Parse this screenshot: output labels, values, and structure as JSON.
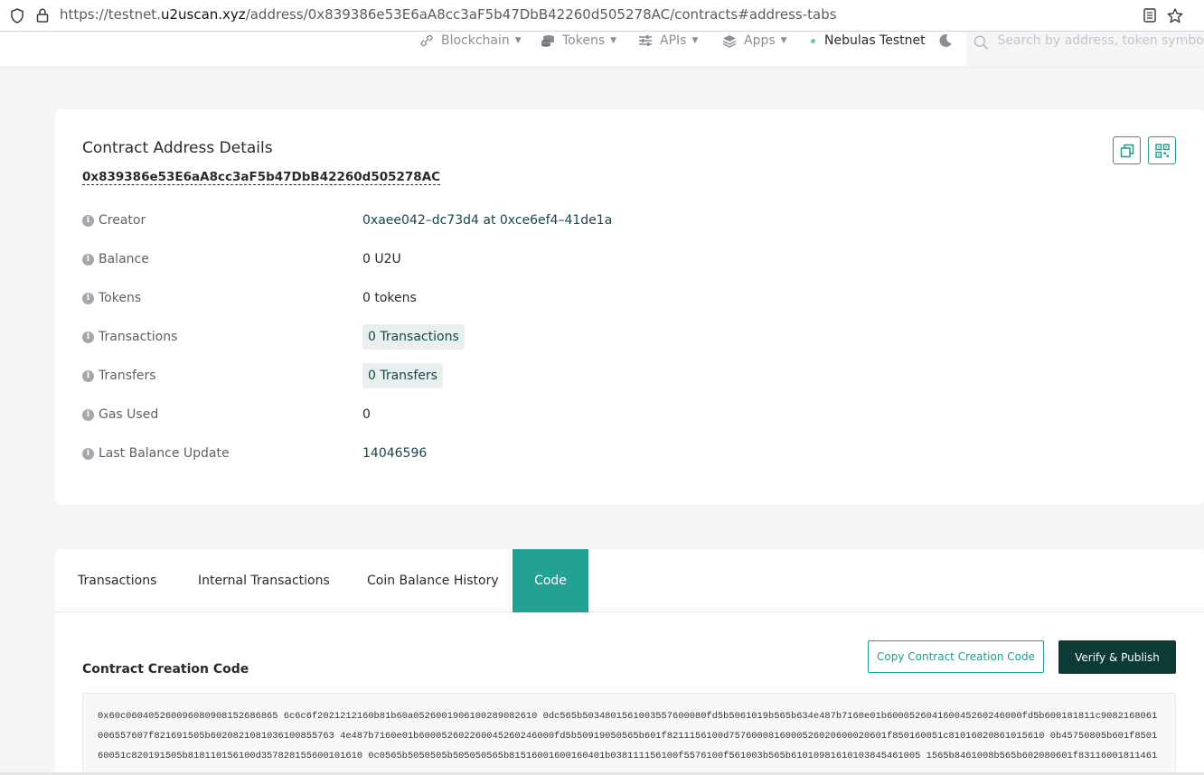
{
  "browser": {
    "url_prefix": "https://testnet.",
    "url_host": "u2uscan.xyz",
    "url_path": "/address/0x839386e53E6aA8cc3aF5b47DbB42260d505278AC/contracts#address-tabs"
  },
  "nav": {
    "items": [
      {
        "label": "Blockchain",
        "icon": "blockchain-icon"
      },
      {
        "label": "Tokens",
        "icon": "tokens-icon"
      },
      {
        "label": "APIs",
        "icon": "apis-icon"
      },
      {
        "label": "Apps",
        "icon": "apps-icon"
      }
    ],
    "network": "Nebulas Testnet",
    "network_dot_color": "#5ad18b",
    "search_placeholder": "Search by address, token symbol, n"
  },
  "details": {
    "title": "Contract Address Details",
    "address": "0x839386e53E6aA8cc3aF5b47DbB42260d505278AC",
    "rows": [
      {
        "label": "Creator",
        "value": "0xaee042–dc73d4 at 0xce6ef4–41de1a"
      },
      {
        "label": "Balance",
        "value": "0 U2U"
      },
      {
        "label": "Tokens",
        "value": "0 tokens"
      },
      {
        "label": "Transactions",
        "value": "0 Transactions"
      },
      {
        "label": "Transfers",
        "value": "0 Transfers"
      },
      {
        "label": "Gas Used",
        "value": "0"
      },
      {
        "label": "Last Balance Update",
        "value": "14046596"
      }
    ]
  },
  "tabs": [
    "Transactions",
    "Internal Transactions",
    "Coin Balance History",
    "Code"
  ],
  "active_tab": "Code",
  "code": {
    "title": "Contract Creation Code",
    "copy_button": "Copy Contract Creation Code",
    "verify_button": "Verify & Publish",
    "lines": [
      "0x60c060405260096080908152686865 6c6c6f2021212160b81b60a0526001906100289082610 0dc565b5034801561003557600080fd5b5061019b565b634e487b7160e01b600052604160045260246000fd5b600181811c9082168061",
      "006557607f821691505b6020821081036100855763 4e487b7160e01b600052602260045260246000fd5b50919050565b601f8211156100d7576000816000526020600020601f850160051c81016020861015610 0b45750805b601f8501",
      "60051c820191505b818110156100d357828155600101610 0c0565b5050505b505050565b81516001600160401b038111156100f5576100f561003b565b61010981610103845461005 1565b8461008b565b602080601f83116001811461"
    ]
  },
  "colors": {
    "accent": "#23a193",
    "accent_border": "#1e9a8b",
    "dark_button": "#0e3a36"
  }
}
